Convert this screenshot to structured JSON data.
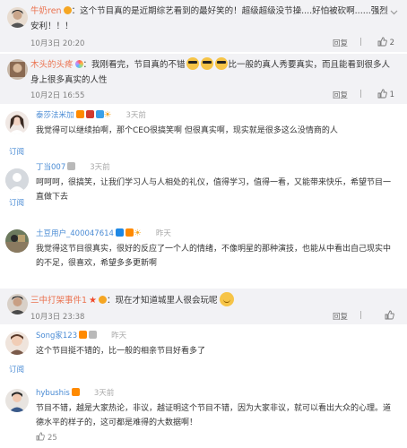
{
  "posts": [
    {
      "username": "牛奶ren",
      "text": "：这个节目真的是近期综艺看到的最好笑的！超级超级没节操....好怕被砍啊......强烈安利！！！",
      "time": "10月3日 20:20",
      "reply": "回复",
      "likes": "2"
    },
    {
      "username": "木头的头疼",
      "text": "：我刚看完，节目真的不错",
      "text2": "比一般的真人秀要真实，而且能看到很多人身上很多真实的人性",
      "time": "10月2日 16:55",
      "reply": "回复",
      "likes": "1"
    },
    {
      "username": "三中打架事件1",
      "text": "：现在才知道城里人很会玩呢",
      "time": "10月3日 23:38",
      "reply": "回复",
      "likes": ""
    }
  ],
  "comments": [
    {
      "username": "泰莎法米加",
      "when": "3天前",
      "text": "我觉得可以继续拍啊，那个CEO很搞笑啊 但很真实啊，现实就是很多这么没情商的人",
      "follow": "订阅"
    },
    {
      "username": "丁当007",
      "when": "3天前",
      "text": "呵呵呵，很搞笑，让我们学习人与人相处的礼仪，值得学习，值得一看，又能带来快乐，希望节目一直做下去",
      "follow": "订阅"
    },
    {
      "username": "土豆用户_400047614",
      "when": "昨天",
      "text": "我觉得这节目很真实，很好的反应了一个人的情绪，不像明星的那种演技，也能从中看出自己现实中的不足，很喜欢，希望多多更新啊",
      "follow": ""
    },
    {
      "username": "Song家123",
      "when": "昨天",
      "text": "这个节目挺不错的，比一般的相亲节目好看多了",
      "follow": "订阅"
    },
    {
      "username": "hybushis",
      "when": "3天前",
      "text": "节目不错，越是大家热论，非议，越证明这个节目不错，因为大家非议，就可以看出大众的心理。道德水平的样子的，这可都是难得的大数据啊！",
      "likes": "25",
      "follow": ""
    }
  ],
  "colors": {
    "weibo_bg": "#f2f2f5",
    "username_weibo": "#eb7350",
    "username_comment": "#4a8bd4"
  }
}
